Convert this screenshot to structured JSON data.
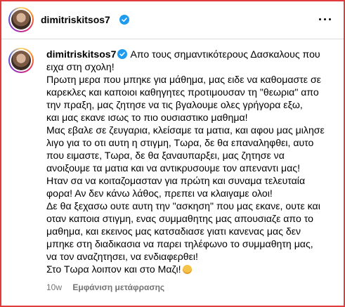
{
  "post": {
    "username": "dimitriskitsos7",
    "menu_icon": "more-horizontal-icon"
  },
  "comment": {
    "username": "dimitriskitsos7",
    "lines": [
      "Απο τους σημαντικότερους Δασκαλους που",
      "ειχα στη σχολη!",
      "Πρωτη μερα που μπηκε για μάθημα, μας ειδε να καθομαστε σε",
      "καρεκλες και καποιοι καθηγητες προτιμουσαν τη \"θεωρια\" απο",
      "την πραξη, μας ζητησε να τις βγαλουμε ολες γρήγορα εξω,",
      "και μας εκανε ισως το πιο ουσιαστικο μαθημα!",
      "Μας εβαλε σε ζευγαρια, κλείσαμε τα ματια, και αφου μας μιλησε",
      "λιγο για το οτι αυτη η στιγμη, Τωρα, δε θα επαναληφθει, αυτο",
      "που ειμαστε, Τωρα, δε θα ξαναυπαρξει, μας ζητησε να",
      "ανοιξουμε τα ματια και να αντικρυσουμε τον απεναντι μας!",
      "Ηταν σα να κοιταζομασταν για πρώτη και συναμα τελευταία",
      "φορα! Αν δεν κάνω λάθος, πρεπει να κλαιγαμε ολοι!",
      "Δε θα ξεχασω ουτε αυτη την \"ασκηση\" που μας εκανε, ουτε και",
      "οταν καποια στιγμη, ενας συμμαθητης μας απουσιαζε απο το",
      "μαθημα, και εκεινος μας κατσαδιασε γιατι κανενας μας δεν",
      "μπηκε στη διαδικασια να παρει τηλέφωνο το συμμαθητη μας,",
      "να τον αναζητησει, να ενδιαφερθει!",
      "Στο Τωρα λοιπον και στο Μαζι!"
    ],
    "emoji": "smiling-face-icon",
    "time": "10w",
    "translate_label": "Εμφάνιση μετάφρασης"
  }
}
